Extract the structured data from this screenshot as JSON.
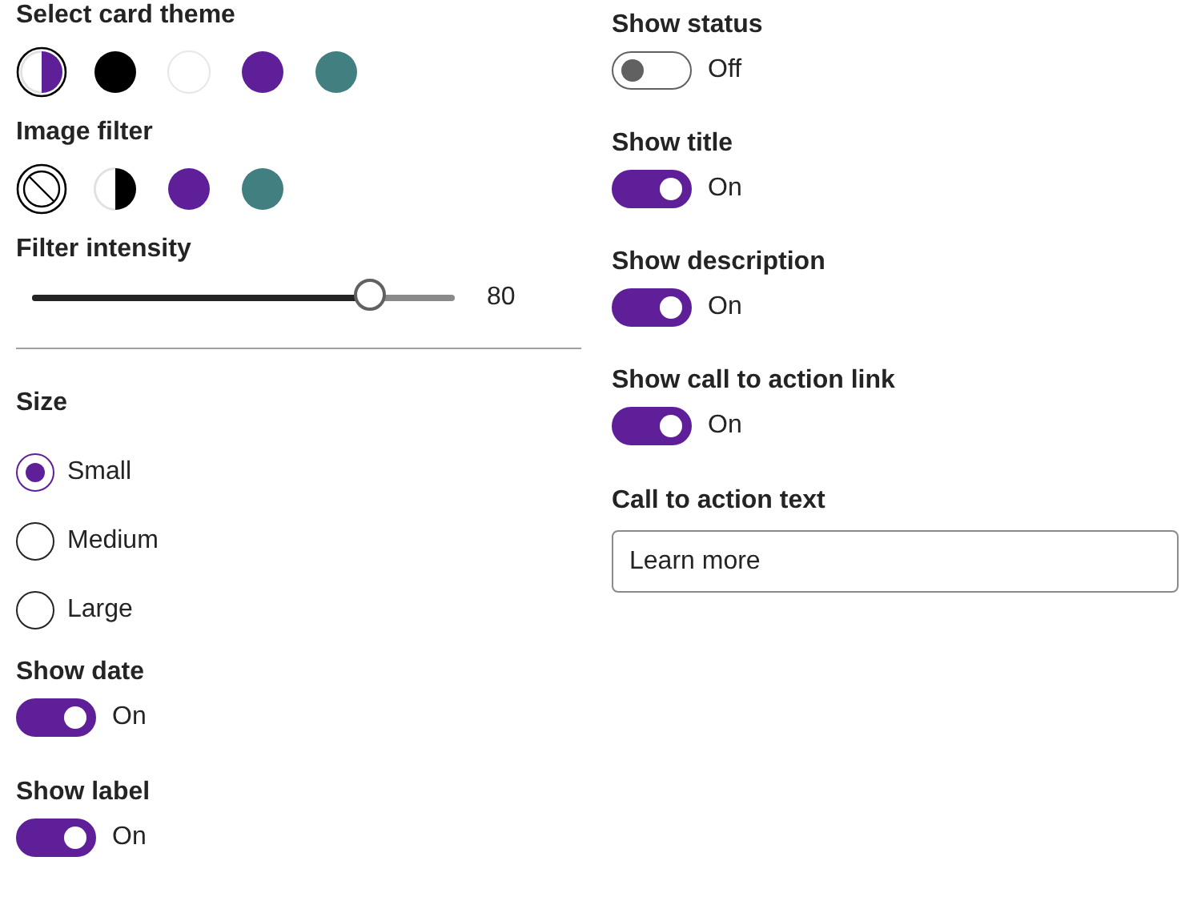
{
  "card_theme": {
    "label": "Select card theme",
    "swatches": [
      {
        "kind": "split",
        "color": "#5f1f99",
        "selected": true
      },
      {
        "kind": "solid",
        "color": "#000000",
        "selected": false
      },
      {
        "kind": "solid",
        "color": "#ffffff",
        "selected": false
      },
      {
        "kind": "solid",
        "color": "#5f1f99",
        "selected": false
      },
      {
        "kind": "solid",
        "color": "#417f80",
        "selected": false
      }
    ]
  },
  "image_filter": {
    "label": "Image filter",
    "swatches": [
      {
        "kind": "none",
        "selected": true
      },
      {
        "kind": "split",
        "color": "#000000",
        "selected": false
      },
      {
        "kind": "solid",
        "color": "#5f1f99",
        "selected": false
      },
      {
        "kind": "solid",
        "color": "#417f80",
        "selected": false
      }
    ]
  },
  "filter_intensity": {
    "label": "Filter intensity",
    "level": 0.8,
    "reading": "80"
  },
  "size": {
    "label": "Size",
    "options": [
      {
        "label": "Small",
        "selected": true
      },
      {
        "label": "Medium",
        "selected": false
      },
      {
        "label": "Large",
        "selected": false
      }
    ]
  },
  "left_toggles": [
    {
      "label": "Show date",
      "on": true,
      "state": "On"
    },
    {
      "label": "Show label",
      "on": true,
      "state": "On"
    }
  ],
  "right_toggles": [
    {
      "label": "Show status",
      "on": false,
      "state": "Off"
    },
    {
      "label": "Show title",
      "on": true,
      "state": "On"
    },
    {
      "label": "Show description",
      "on": true,
      "state": "On"
    },
    {
      "label": "Show call to action link",
      "on": true,
      "state": "On"
    }
  ],
  "call_to_action": {
    "label": "Call to action text",
    "value": "Learn more"
  }
}
